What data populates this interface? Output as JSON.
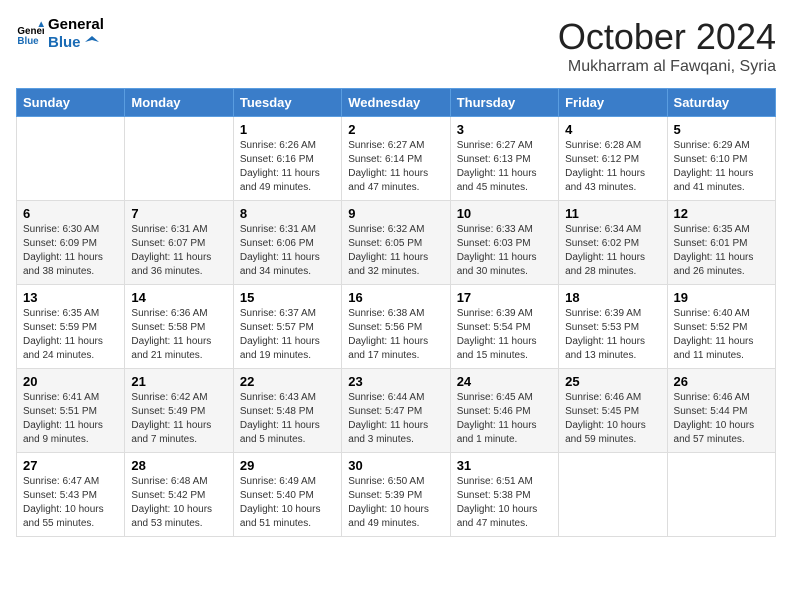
{
  "logo": {
    "line1": "General",
    "line2": "Blue"
  },
  "title": "October 2024",
  "location": "Mukharram al Fawqani, Syria",
  "weekdays": [
    "Sunday",
    "Monday",
    "Tuesday",
    "Wednesday",
    "Thursday",
    "Friday",
    "Saturday"
  ],
  "weeks": [
    [
      {
        "day": "",
        "info": ""
      },
      {
        "day": "",
        "info": ""
      },
      {
        "day": "1",
        "info": "Sunrise: 6:26 AM\nSunset: 6:16 PM\nDaylight: 11 hours and 49 minutes."
      },
      {
        "day": "2",
        "info": "Sunrise: 6:27 AM\nSunset: 6:14 PM\nDaylight: 11 hours and 47 minutes."
      },
      {
        "day": "3",
        "info": "Sunrise: 6:27 AM\nSunset: 6:13 PM\nDaylight: 11 hours and 45 minutes."
      },
      {
        "day": "4",
        "info": "Sunrise: 6:28 AM\nSunset: 6:12 PM\nDaylight: 11 hours and 43 minutes."
      },
      {
        "day": "5",
        "info": "Sunrise: 6:29 AM\nSunset: 6:10 PM\nDaylight: 11 hours and 41 minutes."
      }
    ],
    [
      {
        "day": "6",
        "info": "Sunrise: 6:30 AM\nSunset: 6:09 PM\nDaylight: 11 hours and 38 minutes."
      },
      {
        "day": "7",
        "info": "Sunrise: 6:31 AM\nSunset: 6:07 PM\nDaylight: 11 hours and 36 minutes."
      },
      {
        "day": "8",
        "info": "Sunrise: 6:31 AM\nSunset: 6:06 PM\nDaylight: 11 hours and 34 minutes."
      },
      {
        "day": "9",
        "info": "Sunrise: 6:32 AM\nSunset: 6:05 PM\nDaylight: 11 hours and 32 minutes."
      },
      {
        "day": "10",
        "info": "Sunrise: 6:33 AM\nSunset: 6:03 PM\nDaylight: 11 hours and 30 minutes."
      },
      {
        "day": "11",
        "info": "Sunrise: 6:34 AM\nSunset: 6:02 PM\nDaylight: 11 hours and 28 minutes."
      },
      {
        "day": "12",
        "info": "Sunrise: 6:35 AM\nSunset: 6:01 PM\nDaylight: 11 hours and 26 minutes."
      }
    ],
    [
      {
        "day": "13",
        "info": "Sunrise: 6:35 AM\nSunset: 5:59 PM\nDaylight: 11 hours and 24 minutes."
      },
      {
        "day": "14",
        "info": "Sunrise: 6:36 AM\nSunset: 5:58 PM\nDaylight: 11 hours and 21 minutes."
      },
      {
        "day": "15",
        "info": "Sunrise: 6:37 AM\nSunset: 5:57 PM\nDaylight: 11 hours and 19 minutes."
      },
      {
        "day": "16",
        "info": "Sunrise: 6:38 AM\nSunset: 5:56 PM\nDaylight: 11 hours and 17 minutes."
      },
      {
        "day": "17",
        "info": "Sunrise: 6:39 AM\nSunset: 5:54 PM\nDaylight: 11 hours and 15 minutes."
      },
      {
        "day": "18",
        "info": "Sunrise: 6:39 AM\nSunset: 5:53 PM\nDaylight: 11 hours and 13 minutes."
      },
      {
        "day": "19",
        "info": "Sunrise: 6:40 AM\nSunset: 5:52 PM\nDaylight: 11 hours and 11 minutes."
      }
    ],
    [
      {
        "day": "20",
        "info": "Sunrise: 6:41 AM\nSunset: 5:51 PM\nDaylight: 11 hours and 9 minutes."
      },
      {
        "day": "21",
        "info": "Sunrise: 6:42 AM\nSunset: 5:49 PM\nDaylight: 11 hours and 7 minutes."
      },
      {
        "day": "22",
        "info": "Sunrise: 6:43 AM\nSunset: 5:48 PM\nDaylight: 11 hours and 5 minutes."
      },
      {
        "day": "23",
        "info": "Sunrise: 6:44 AM\nSunset: 5:47 PM\nDaylight: 11 hours and 3 minutes."
      },
      {
        "day": "24",
        "info": "Sunrise: 6:45 AM\nSunset: 5:46 PM\nDaylight: 11 hours and 1 minute."
      },
      {
        "day": "25",
        "info": "Sunrise: 6:46 AM\nSunset: 5:45 PM\nDaylight: 10 hours and 59 minutes."
      },
      {
        "day": "26",
        "info": "Sunrise: 6:46 AM\nSunset: 5:44 PM\nDaylight: 10 hours and 57 minutes."
      }
    ],
    [
      {
        "day": "27",
        "info": "Sunrise: 6:47 AM\nSunset: 5:43 PM\nDaylight: 10 hours and 55 minutes."
      },
      {
        "day": "28",
        "info": "Sunrise: 6:48 AM\nSunset: 5:42 PM\nDaylight: 10 hours and 53 minutes."
      },
      {
        "day": "29",
        "info": "Sunrise: 6:49 AM\nSunset: 5:40 PM\nDaylight: 10 hours and 51 minutes."
      },
      {
        "day": "30",
        "info": "Sunrise: 6:50 AM\nSunset: 5:39 PM\nDaylight: 10 hours and 49 minutes."
      },
      {
        "day": "31",
        "info": "Sunrise: 6:51 AM\nSunset: 5:38 PM\nDaylight: 10 hours and 47 minutes."
      },
      {
        "day": "",
        "info": ""
      },
      {
        "day": "",
        "info": ""
      }
    ]
  ]
}
